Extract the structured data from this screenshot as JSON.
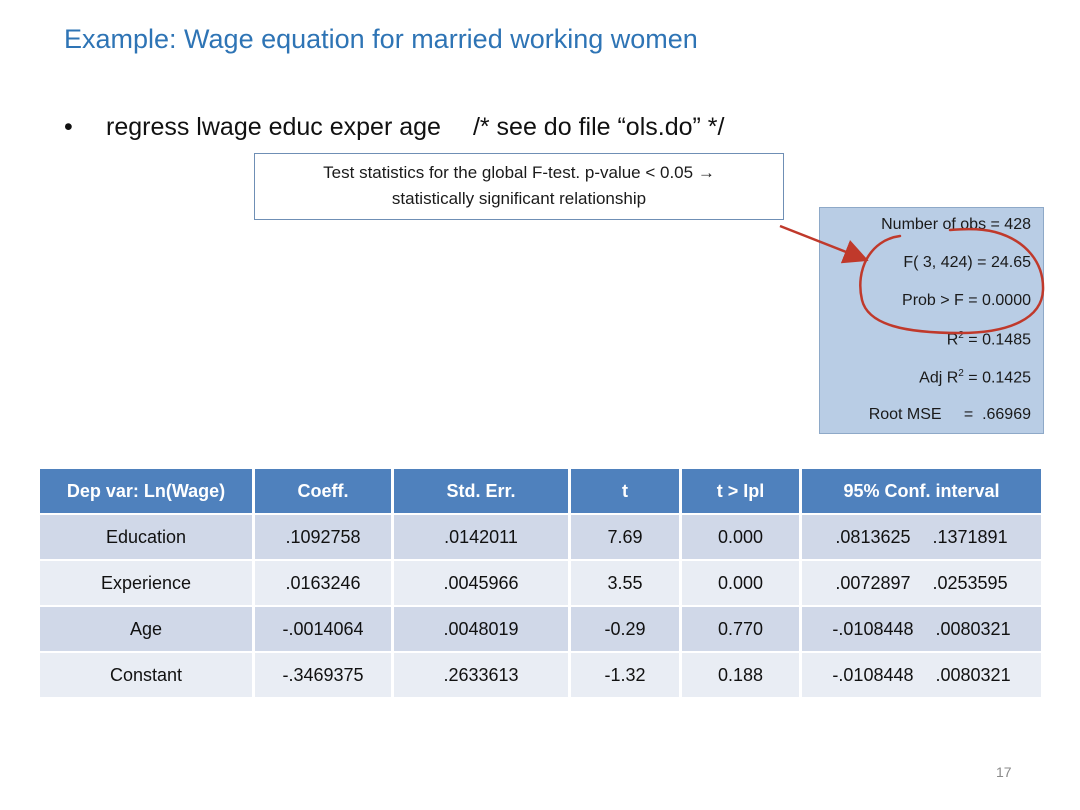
{
  "slide": {
    "title": "Example: Wage equation for married working women",
    "bullet_symbol": "•",
    "command": "regress lwage educ exper age",
    "comment": "/* see do file “ols.do” */",
    "page_number": "17"
  },
  "callout": {
    "line1": "Test statistics for the global F-test. p-value < 0.05 →",
    "line2": "statistically significant relationship"
  },
  "stats": {
    "nobs": "Number of obs = 428",
    "f_stat": "F( 3, 424) =  24.65",
    "prob_f": "Prob > F = 0.0000",
    "r2_label": "R",
    "r2_value": " = 0.1485",
    "adj_r2_label": "Adj R",
    "adj_r2_value": " =  0.1425",
    "root_mse": "Root MSE     =  .66969",
    "squared": "2"
  },
  "table": {
    "headers": [
      "Dep var: Ln(Wage)",
      "Coeff.",
      "Std. Err.",
      "t",
      "t > Ipl",
      "95% Conf. interval"
    ],
    "rows": [
      {
        "var": "Education",
        "coef": ".1092758",
        "se": ".0142011",
        "t": "7.69",
        "p": "0.000",
        "ci_lo": ".0813625",
        "ci_hi": ".1371891"
      },
      {
        "var": "Experience",
        "coef": ".0163246",
        "se": ".0045966",
        "t": "3.55",
        "p": "0.000",
        "ci_lo": ".0072897",
        "ci_hi": ".0253595"
      },
      {
        "var": "Age",
        "coef": "-.0014064",
        "se": ".0048019",
        "t": "-0.29",
        "p": "0.770",
        "ci_lo": "-.0108448",
        "ci_hi": ".0080321"
      },
      {
        "var": "Constant",
        "coef": "-.3469375",
        "se": ".2633613",
        "t": "-1.32",
        "p": "0.188",
        "ci_lo": "-.0108448",
        "ci_hi": ".0080321"
      }
    ]
  },
  "colors": {
    "title": "#2e74b5",
    "header_bg": "#4f81bd",
    "row_odd": "#d0d8e8",
    "row_even": "#e9edf4",
    "stats_bg": "#b9cde5",
    "annotation_red": "#c0392b"
  }
}
